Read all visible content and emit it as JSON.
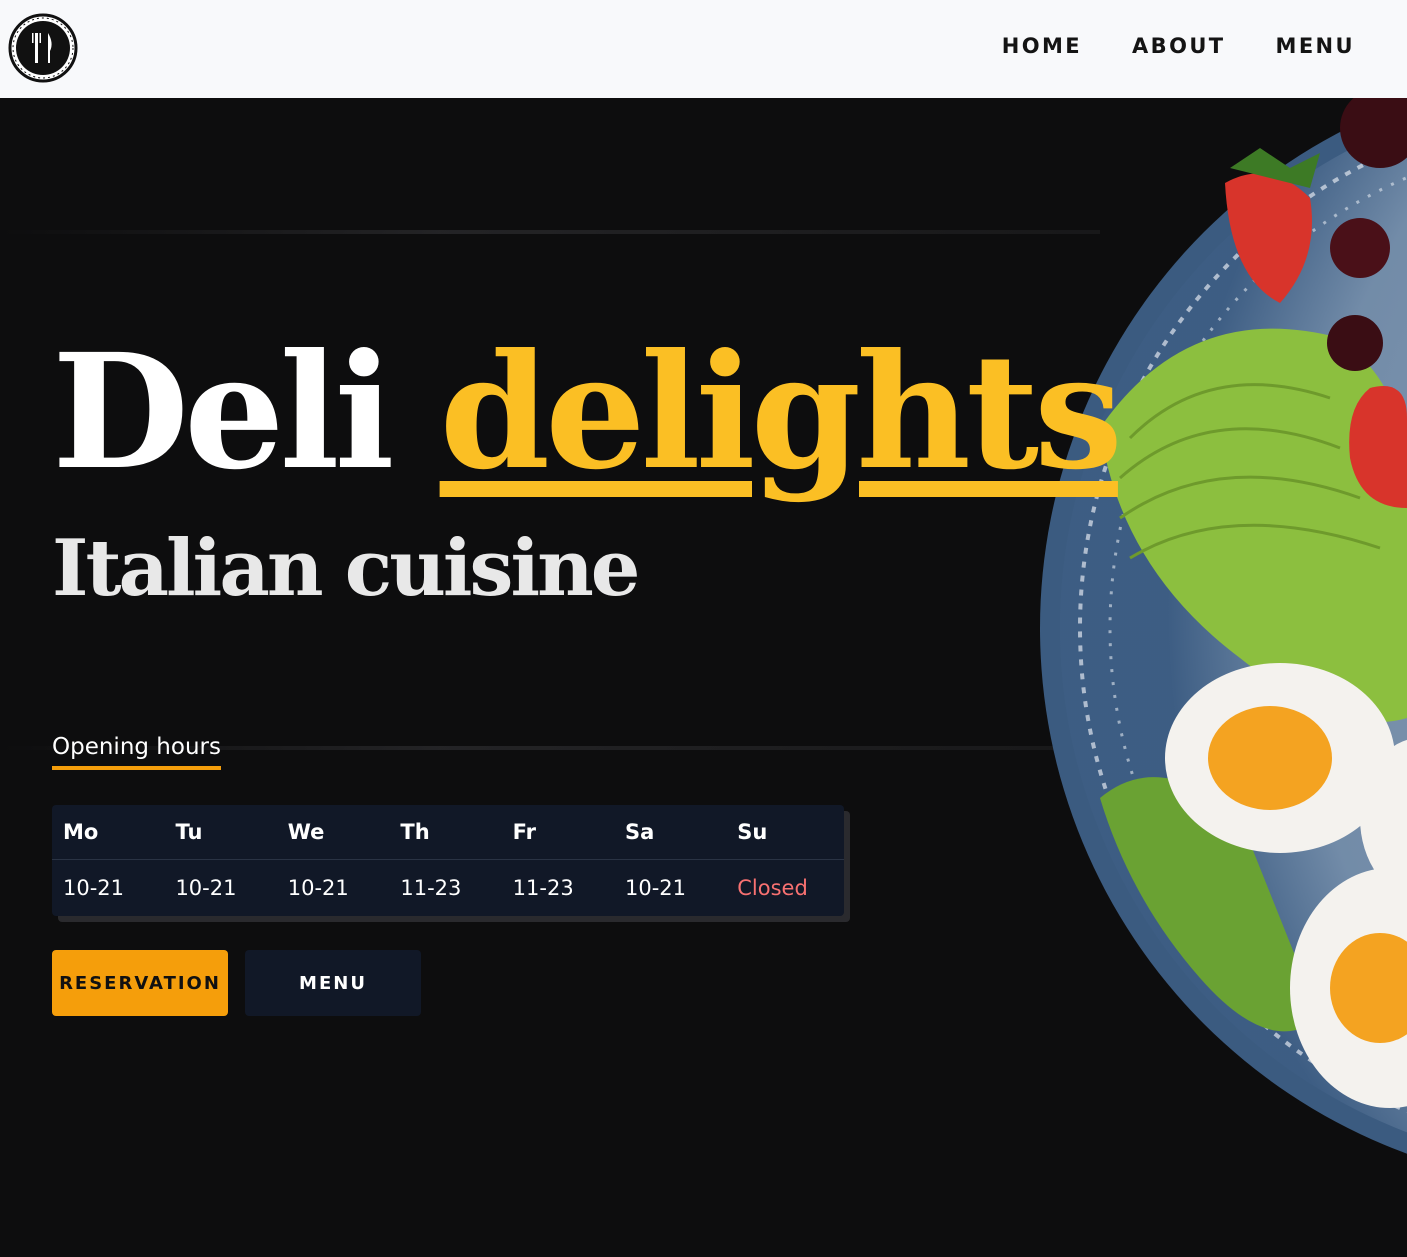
{
  "nav": {
    "items": [
      {
        "label": "HOME"
      },
      {
        "label": "ABOUT"
      },
      {
        "label": "MENU"
      }
    ]
  },
  "hero": {
    "title_main": "Deli",
    "title_accent": "delights",
    "subtitle": "Italian cuisine",
    "hours_label": "Opening hours",
    "hours": {
      "days": [
        "Mo",
        "Tu",
        "We",
        "Th",
        "Fr",
        "Sa",
        "Su"
      ],
      "times": [
        "10-21",
        "10-21",
        "10-21",
        "11-23",
        "11-23",
        "10-21",
        "Closed"
      ]
    },
    "reservation_label": "RESERVATION",
    "menu_label": "MENU"
  },
  "colors": {
    "accent": "#fbbf24",
    "button_primary": "#f59e0b",
    "table_bg": "#111827",
    "closed": "#f87171",
    "header_bg": "#f8f9fb",
    "background": "#0d0d0e"
  },
  "icons": {
    "logo": "fork-knife-icon"
  }
}
